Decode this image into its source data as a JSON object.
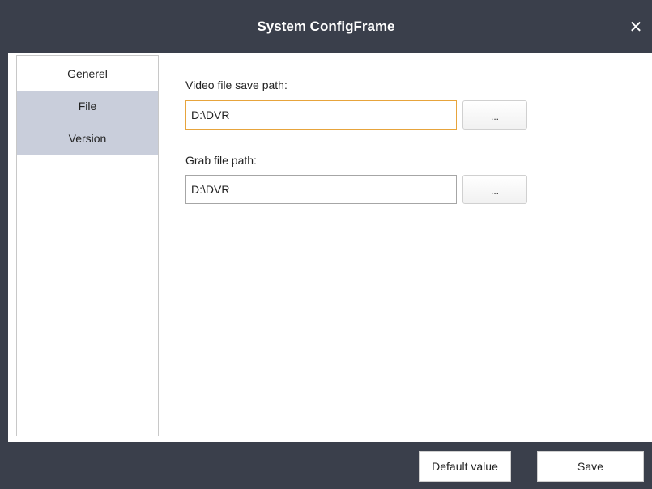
{
  "window": {
    "title": "System ConfigFrame",
    "close_glyph": "✕"
  },
  "sidebar": {
    "items": [
      {
        "label": "Generel",
        "selected": false
      },
      {
        "label": "File",
        "selected": true
      },
      {
        "label": "Version",
        "selected": true
      }
    ]
  },
  "file_settings": {
    "video_path": {
      "label": "Video file save path:",
      "value": "D:\\DVR",
      "browse_label": "..."
    },
    "grab_path": {
      "label": "Grab file path:",
      "value": "D:\\DVR",
      "browse_label": "..."
    }
  },
  "footer": {
    "default_label": "Default value",
    "save_label": "Save"
  },
  "colors": {
    "frame": "#3a3f4b",
    "selected_nav": "#c9cedb",
    "focus_border": "#e7a43c"
  }
}
